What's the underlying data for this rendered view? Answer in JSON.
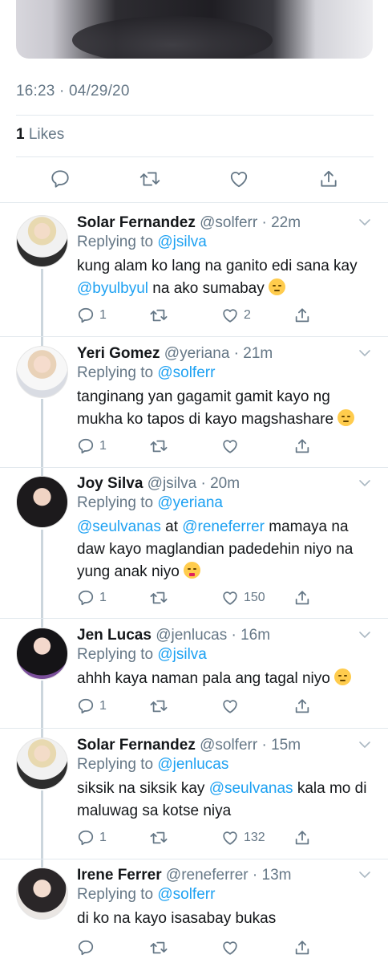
{
  "tweet": {
    "timestamp": "16:23 · 04/29/20",
    "likes_count": "1",
    "likes_label": " Likes"
  },
  "replies": [
    {
      "name": "Solar Fernandez",
      "handle": "@solferr",
      "time": "22m",
      "replying_label": "Replying to ",
      "replying_to": "@jsilva",
      "text_parts": [
        "kung alam ko lang na ganito edi sana kay ",
        "@byulbyul",
        " na ako sumabay "
      ],
      "reply_count": "1",
      "like_count": "2",
      "emoji": "pensive-emoji"
    },
    {
      "name": "Yeri Gomez",
      "handle": "@yeriana",
      "time": "21m",
      "replying_label": "Replying to ",
      "replying_to": "@solferr",
      "text_parts": [
        "tanginang yan gagamit gamit kayo ng mukha ko tapos di kayo magshashare "
      ],
      "reply_count": "1",
      "like_count": "",
      "emoji": "smirk-emoji"
    },
    {
      "name": "Joy Silva",
      "handle": "@jsilva",
      "time": "20m",
      "replying_label": "Replying to ",
      "replying_to": "@yeriana",
      "text_parts": [
        "@seulvanas",
        " at ",
        "@reneferrer",
        " mamaya na daw kayo maglandian padedehin niyo na yung anak niyo "
      ],
      "reply_count": "1",
      "like_count": "150",
      "emoji": "zany-face-emoji"
    },
    {
      "name": "Jen Lucas",
      "handle": "@jenlucas",
      "time": "16m",
      "replying_label": "Replying to ",
      "replying_to": "@jsilva",
      "text_parts": [
        "ahhh kaya naman pala ang tagal niyo "
      ],
      "reply_count": "1",
      "like_count": "",
      "emoji": "smirk-emoji"
    },
    {
      "name": "Solar Fernandez",
      "handle": "@solferr",
      "time": "15m",
      "replying_label": "Replying to ",
      "replying_to": "@jenlucas",
      "text_parts": [
        "siksik na siksik kay ",
        "@seulvanas",
        " kala mo di maluwag sa kotse niya"
      ],
      "reply_count": "1",
      "like_count": "132",
      "emoji": ""
    },
    {
      "name": "Irene Ferrer",
      "handle": "@reneferrer",
      "time": "13m",
      "replying_label": "Replying to ",
      "replying_to": "@solferr",
      "text_parts": [
        "di ko na kayo isasabay bukas"
      ],
      "reply_count": "",
      "like_count": "",
      "emoji": ""
    }
  ],
  "colors": {
    "link": "#1da1f2",
    "secondary_text": "#657786",
    "primary_text": "#14171a",
    "divider": "#e1e8ed"
  },
  "icons": [
    "reply-icon",
    "retweet-icon",
    "like-icon",
    "share-icon",
    "chevron-down-icon"
  ]
}
